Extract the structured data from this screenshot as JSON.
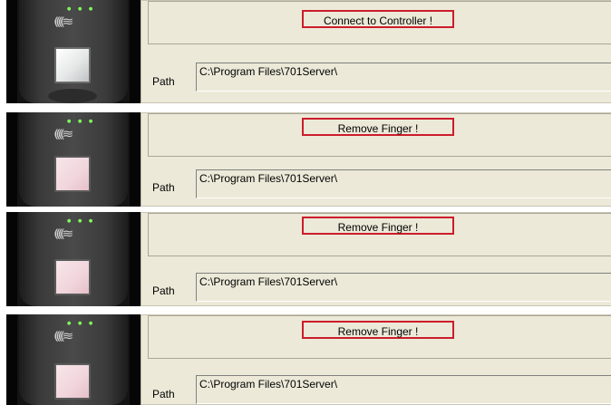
{
  "panels": [
    {
      "status_text": "Connect to Controller !",
      "path_label": "Path",
      "path_value": "C:\\Program Files\\701Server\\",
      "sensor_state": "idle-lit"
    },
    {
      "status_text": "Remove Finger !",
      "path_label": "Path",
      "path_value": "C:\\Program Files\\701Server\\",
      "sensor_state": "finger-detected"
    },
    {
      "status_text": "Remove Finger !",
      "path_label": "Path",
      "path_value": "C:\\Program Files\\701Server\\",
      "sensor_state": "finger-detected"
    },
    {
      "status_text": "Remove Finger !",
      "path_label": "Path",
      "path_value": "C:\\Program Files\\701Server\\",
      "sensor_state": "finger-detected"
    }
  ],
  "colors": {
    "highlight": "#cc1c2b",
    "dialog_bg": "#ece9d8",
    "sensor_idle": "#e6e8e8",
    "sensor_finger": "#f1d5dc"
  },
  "icons": [
    "down-arrow-indicator",
    "wireless-signal-icon",
    "status-led-icon"
  ]
}
